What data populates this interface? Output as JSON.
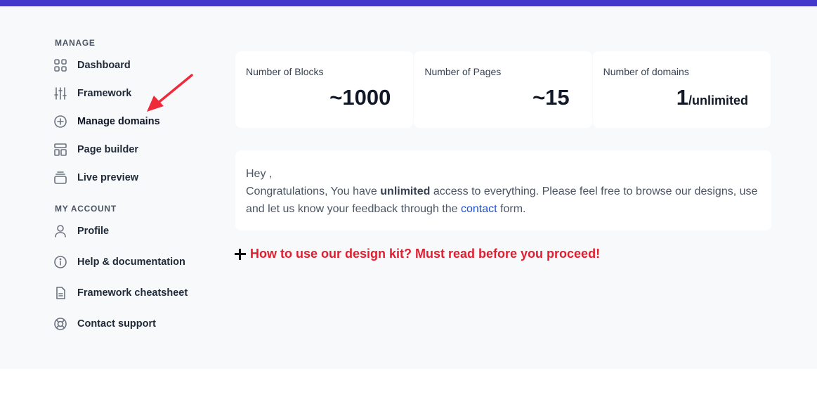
{
  "sidebar": {
    "manage_title": "MANAGE",
    "account_title": "MY ACCOUNT",
    "manage_items": [
      {
        "label": "Dashboard",
        "icon": "grid-icon"
      },
      {
        "label": "Framework",
        "icon": "sliders-icon"
      },
      {
        "label": "Manage domains",
        "icon": "plus-circle-icon"
      },
      {
        "label": "Page builder",
        "icon": "layout-icon"
      },
      {
        "label": "Live preview",
        "icon": "stack-icon"
      }
    ],
    "account_items": [
      {
        "label": "Profile",
        "icon": "user-icon"
      },
      {
        "label": "Help & documentation",
        "icon": "info-circle-icon"
      },
      {
        "label": "Framework cheatsheet",
        "icon": "document-icon"
      },
      {
        "label": "Contact support",
        "icon": "lifebuoy-icon"
      }
    ]
  },
  "stats": [
    {
      "label": "Number of Blocks",
      "value": "~1000"
    },
    {
      "label": "Number of Pages",
      "value": "~15"
    },
    {
      "label": "Number of domains",
      "value": "1",
      "suffix": "/unlimited"
    }
  ],
  "welcome": {
    "greeting": "Hey ,",
    "line_part1": "Congratulations, You have ",
    "line_bold": "unlimited",
    "line_part2": " access to everything. Please feel free to browse our designs, use and let us know your feedback through the ",
    "link_text": "contact",
    "line_part3": " form."
  },
  "guide": {
    "text": "How to use our design kit? Must read before you proceed!"
  },
  "colors": {
    "accent_bar": "#4338ca",
    "annotation_arrow": "#ef2b3a",
    "guide_text": "#e11d2e",
    "link": "#1d4ed8"
  }
}
